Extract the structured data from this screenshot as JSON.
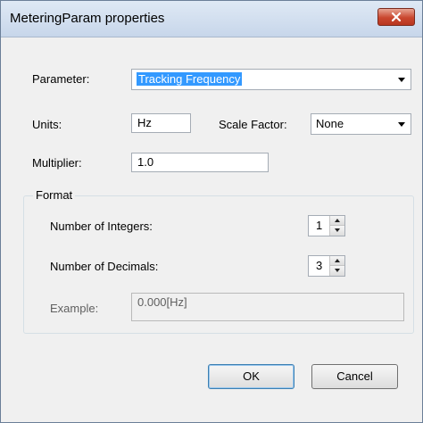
{
  "window": {
    "title": "MeteringParam properties",
    "close_icon": "close-icon"
  },
  "colors": {
    "selection": "#3399ff",
    "titlebar": "#c7d6ea",
    "close_button": "#c9472f",
    "dialog_bg": "#f0f0f0"
  },
  "parameter": {
    "label": "Parameter:",
    "value": "Tracking Frequency"
  },
  "units": {
    "label": "Units:",
    "value": "Hz"
  },
  "scale_factor": {
    "label": "Scale Factor:",
    "value": "None"
  },
  "multiplier": {
    "label": "Multiplier:",
    "value": "1.0"
  },
  "format": {
    "title": "Format",
    "integers": {
      "label": "Number of Integers:",
      "value": "1"
    },
    "decimals": {
      "label": "Number of Decimals:",
      "value": "3"
    },
    "example": {
      "label": "Example:",
      "value": "0.000[Hz]"
    }
  },
  "buttons": {
    "ok": "OK",
    "cancel": "Cancel"
  }
}
